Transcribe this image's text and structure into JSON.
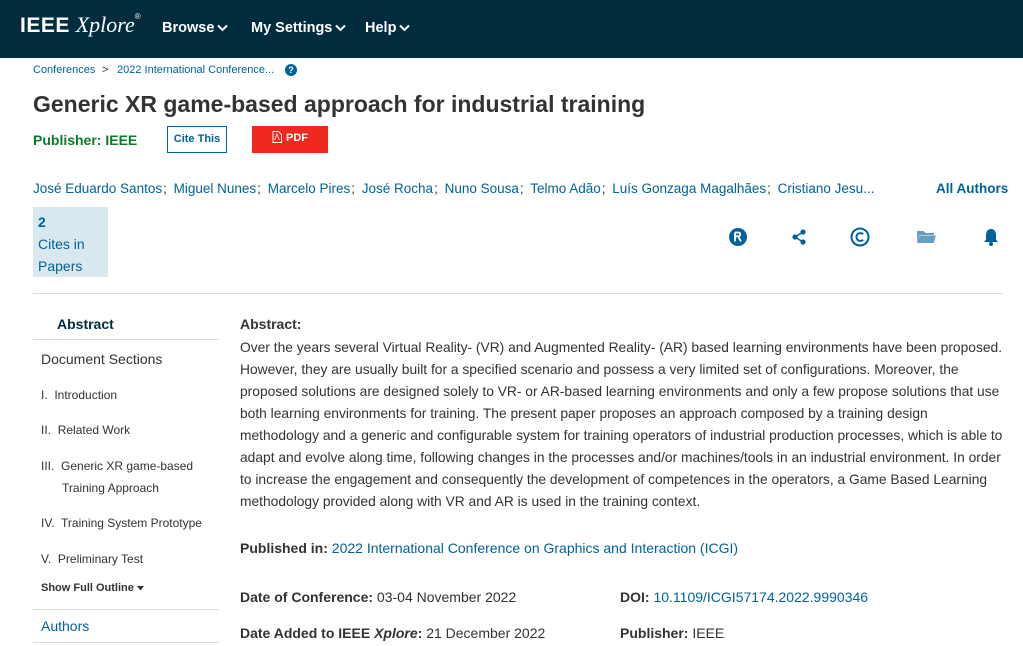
{
  "header": {
    "logo_ieee": "IEEE",
    "logo_xplore": "Xplore",
    "logo_reg": "®",
    "nav": [
      "Browse",
      "My Settings",
      "Help"
    ]
  },
  "breadcrumb": {
    "items": [
      "Conferences",
      "2022 International Conference..."
    ],
    "separator": ">",
    "help": "?"
  },
  "article": {
    "title": "Generic XR game-based approach for industrial training",
    "publisher_label": "Publisher:",
    "publisher": "IEEE",
    "cite_label": "Cite This",
    "pdf_label": "PDF",
    "authors": [
      "José Eduardo Santos",
      "Miguel Nunes",
      "Marcelo Pires",
      "José Rocha",
      "Nuno Sousa",
      "Telmo Adão",
      "Luís Gonzaga Magalhães",
      "Cristiano Jesu..."
    ],
    "author_separator": ";",
    "all_authors_label": "All Authors",
    "metric_count": "2",
    "metric_label_1": "Cites in",
    "metric_label_2": "Papers"
  },
  "toolbar_icons": [
    "rights-icon",
    "share-icon",
    "copyright-icon",
    "folder-icon",
    "alert-bell-icon"
  ],
  "sidebar": {
    "abstract_label": "Abstract",
    "sections_heading": "Document Sections",
    "items": [
      {
        "num": "I.",
        "text": "Introduction",
        "text2": ""
      },
      {
        "num": "II.",
        "text": "Related Work",
        "text2": ""
      },
      {
        "num": "III.",
        "text": "Generic XR game-based",
        "text2": "Training Approach"
      },
      {
        "num": "IV.",
        "text": "Training System Prototype",
        "text2": ""
      },
      {
        "num": "V.",
        "text": "Preliminary Test",
        "text2": ""
      }
    ],
    "show_outline_label": "Show Full Outline",
    "authors_label": "Authors"
  },
  "abstract": {
    "label": "Abstract:",
    "text": "Over the years several Virtual Reality- (VR) and Augmented Reality- (AR) based learning environments have been proposed. However, they are usually built for a specified scenario and possess a very limited set of configurations. Moreover, the proposed solutions are designed solely to VR- or AR-based learning environments and only a few propose solutions that use both learning environments for training. The present paper proposes an approach composed by a training design methodology and a generic and configurable system for training operators of industrial production processes, which is able to adapt and evolve along time, following changes in the processes and/or machines/tools in an industrial environment. In order to increase the engagement and consequently the development of competences in the operators, a Game Based Learning methodology provided along with VR and AR is used in the training context."
  },
  "meta": {
    "published_in_label": "Published in:",
    "published_in": "2022 International Conference on Graphics and Interaction (ICGI)",
    "date_conf_label": "Date of Conference:",
    "date_conf": "03-04 November 2022",
    "doi_label": "DOI:",
    "doi": "10.1109/ICGI57174.2022.9990346",
    "date_added_label_a": "Date Added to IEEE",
    "date_added_label_b": "Xplore",
    "date_added_label_c": ":",
    "date_added": "21 December 2022",
    "publisher_label": "Publisher:",
    "publisher": "IEEE"
  }
}
